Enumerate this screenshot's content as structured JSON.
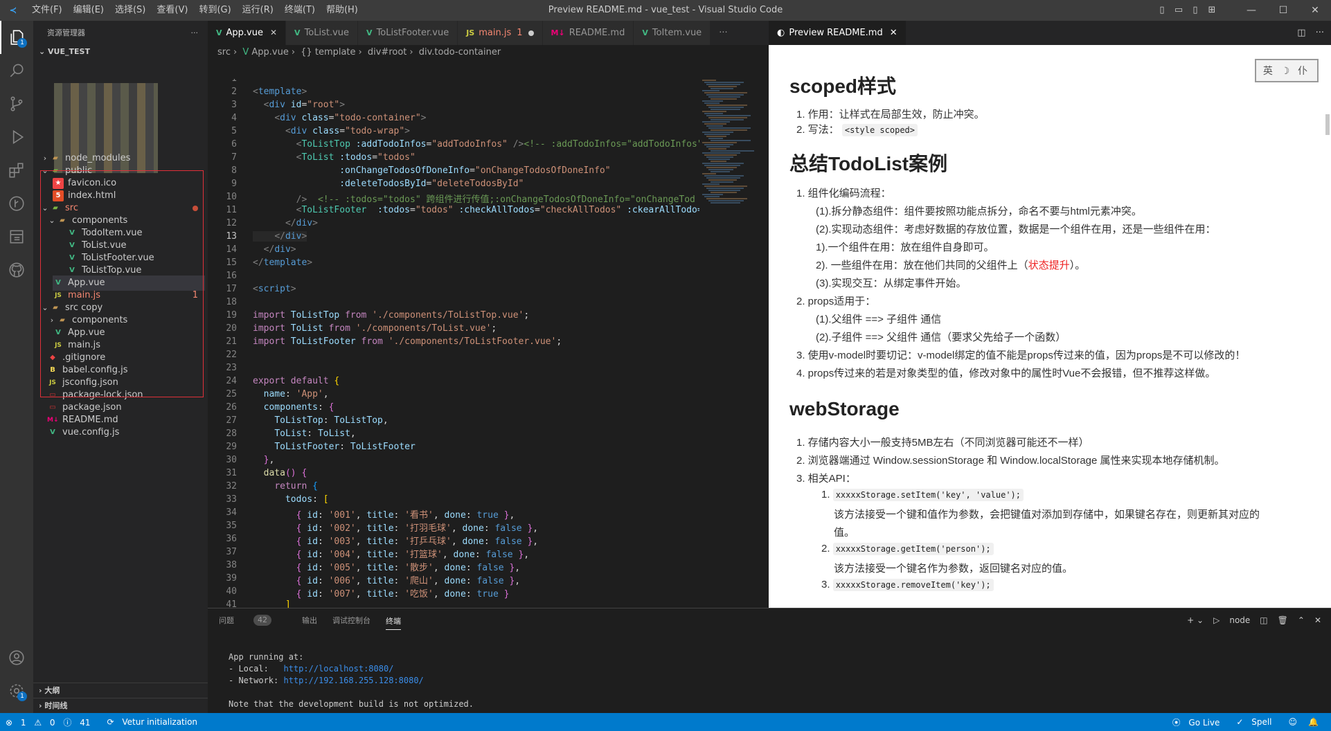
{
  "titlebar": {
    "menus": [
      "文件(F)",
      "编辑(E)",
      "选择(S)",
      "查看(V)",
      "转到(G)",
      "运行(R)",
      "终端(T)",
      "帮助(H)"
    ],
    "title": "Preview README.md - vue_test - Visual Studio Code"
  },
  "activity": {
    "explorer_badge": "1",
    "settings_badge": "1"
  },
  "sidebar": {
    "header": "资源管理器",
    "project": "VUE_TEST",
    "items": [
      {
        "label": "node_modules",
        "icon": "folder"
      },
      {
        "label": "public",
        "icon": "folder-open"
      },
      {
        "label": "favicon.ico",
        "icon": "ico"
      },
      {
        "label": "index.html",
        "icon": "html"
      },
      {
        "label": "src",
        "icon": "folder-open"
      },
      {
        "label": "components",
        "icon": "folder-open"
      },
      {
        "label": "TodoItem.vue",
        "icon": "vue"
      },
      {
        "label": "ToList.vue",
        "icon": "vue"
      },
      {
        "label": "ToListFooter.vue",
        "icon": "vue"
      },
      {
        "label": "ToListTop.vue",
        "icon": "vue"
      },
      {
        "label": "App.vue",
        "icon": "vue"
      },
      {
        "label": "main.js",
        "icon": "js",
        "badge": "1"
      },
      {
        "label": "src copy",
        "icon": "folder-open"
      },
      {
        "label": "components",
        "icon": "folder"
      },
      {
        "label": "App.vue",
        "icon": "vue"
      },
      {
        "label": "main.js",
        "icon": "js"
      },
      {
        "label": ".gitignore",
        "icon": "git"
      },
      {
        "label": "babel.config.js",
        "icon": "babel"
      },
      {
        "label": "jsconfig.json",
        "icon": "json"
      },
      {
        "label": "package-lock.json",
        "icon": "lock"
      },
      {
        "label": "package.json",
        "icon": "lock"
      },
      {
        "label": "README.md",
        "icon": "md"
      },
      {
        "label": "vue.config.js",
        "icon": "vue"
      }
    ],
    "outline": "大纲",
    "timeline": "时间线"
  },
  "editor": {
    "tabs": [
      {
        "label": "App.vue",
        "icon": "V",
        "active": true
      },
      {
        "label": "ToList.vue",
        "icon": "V"
      },
      {
        "label": "ToListFooter.vue",
        "icon": "V"
      },
      {
        "label": "main.js",
        "icon": "JS",
        "badge": "1",
        "modified": true
      },
      {
        "label": "README.md",
        "icon": "M↓"
      },
      {
        "label": "ToItem.vue",
        "icon": "V"
      }
    ],
    "breadcrumb": [
      "src",
      "App.vue",
      "{} template",
      "div#root",
      "div.todo-container"
    ],
    "current_line": 13
  },
  "preview": {
    "tab": "Preview README.md",
    "stamp": "英 ☽ 仆",
    "h1": "scoped样式",
    "s1": [
      "1. 作用：让样式在局部生效，防止冲突。",
      "2. 写法："
    ],
    "s1_code": "<style scoped>",
    "h2": "总结TodoList案例",
    "s2": [
      "1. 组件化编码流程：",
      "(1).拆分静态组件：组件要按照功能点拆分，命名不要与html元素冲突。",
      "(2).实现动态组件：考虑好数据的存放位置，数据是一个组件在用，还是一些组件在用：",
      "1).一个组件在用：放在组件自身即可。",
      "2). 一些组件在用：放在他们共同的父组件上（",
      "状态提升",
      "）。",
      "(3).实现交互：从绑定事件开始。",
      "2. props适用于：",
      "(1).父组件 ==> 子组件 通信",
      "(2).子组件 ==> 父组件 通信（要求父先给子一个函数）",
      "3. 使用v-model时要切记：v-model绑定的值不能是props传过来的值，因为props是不可以修改的！",
      "4. props传过来的若是对象类型的值，修改对象中的属性时Vue不会报错，但不推荐这样做。"
    ],
    "h3": "webStorage",
    "s3": [
      "1. 存储内容大小一般支持5MB左右（不同浏览器可能还不一样）",
      "2. 浏览器端通过 Window.sessionStorage 和 Window.localStorage 属性来实现本地存储机制。",
      "3. 相关API：",
      "1.",
      "xxxxxStorage.setItem('key', 'value');",
      "该方法接受一个键和值作为参数，会把键值对添加到存储中，如果键名存在，则更新其对应的",
      "值。",
      "2.",
      "xxxxxStorage.getItem('person');",
      "该方法接受一个键名作为参数，返回键名对应的值。",
      "3.",
      "xxxxxStorage.removeItem('key');"
    ]
  },
  "panel": {
    "tabs": [
      "问题",
      "输出",
      "调试控制台",
      "终端"
    ],
    "problems_count": "42",
    "terminal_name": "node",
    "terminal": {
      "l1": "App running at:",
      "l2": "- Local:   ",
      "l2_link": "http://localhost:8080/",
      "l3": "- Network: ",
      "l3_link": "http://192.168.255.128:8080/",
      "l4": "Note that the development build is not optimized."
    }
  },
  "status": {
    "errors": "1",
    "warnings": "0",
    "info": "41",
    "vetur": "Vetur initialization",
    "golive": "Go Live",
    "spell": "Spell"
  }
}
